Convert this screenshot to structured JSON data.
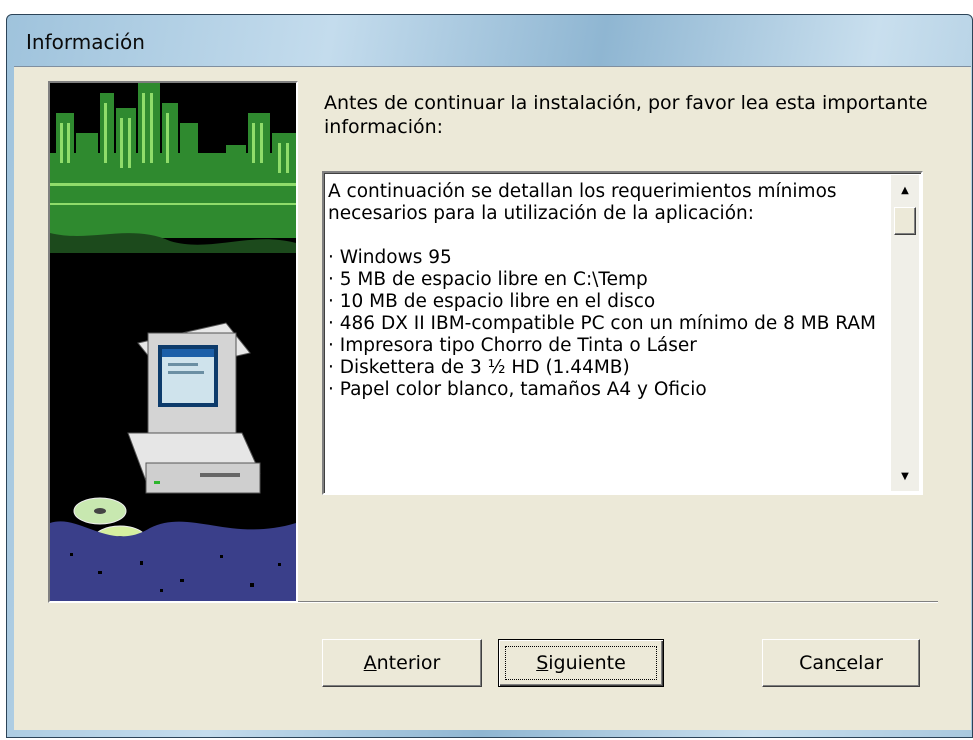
{
  "window": {
    "title": "Información"
  },
  "intro": "Antes de continuar la instalación, por favor lea esta importante información:",
  "info": {
    "text": "A continuación se detallan los requerimientos mínimos necesarios para la utilización de la aplicación:\n\n· Windows 95\n· 5 MB de espacio libre en C:\\Temp\n· 10 MB de espacio libre en el disco\n· 486 DX II IBM-compatible PC con un mínimo de 8 MB RAM\n· Impresora tipo Chorro de Tinta o Láser\n· Diskettera de 3 ½ HD (1.44MB)\n· Papel color blanco, tamaños A4 y Oficio"
  },
  "buttons": {
    "prev": {
      "mnemonic": "A",
      "rest": "nterior"
    },
    "next": {
      "mnemonic": "S",
      "rest": "iguiente"
    },
    "cancel": {
      "pre": "Can",
      "mnemonic": "c",
      "post": "elar"
    }
  },
  "icons": {
    "scroll_up": "scroll-up-arrow-icon",
    "scroll_down": "scroll-down-arrow-icon"
  }
}
